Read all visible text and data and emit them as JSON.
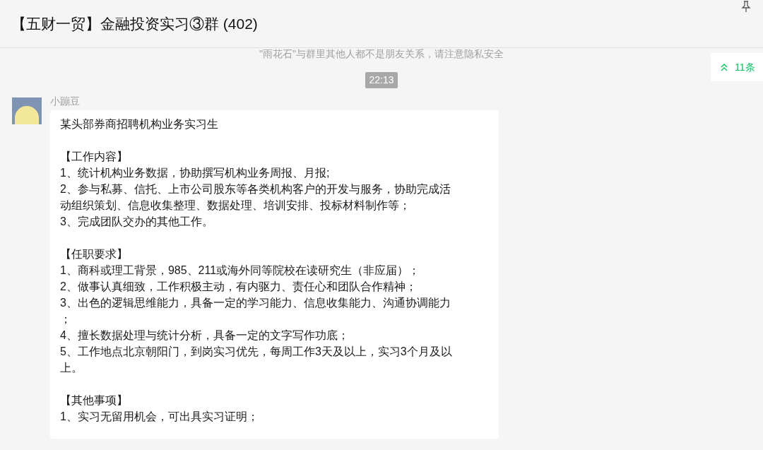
{
  "window": {
    "title": "【五财一贸】金融投资实习③群 (402)"
  },
  "notice": "\"雨花石\"与群里其他人都不是朋友关系，请注意隐私安全",
  "unread_badge": "11条",
  "timestamp": "22:13",
  "message": {
    "sender": "小蹦豆",
    "blocks": [
      [
        "某头部券商招聘机构业务实习生"
      ],
      [
        "【工作内容】",
        "1、统计机构业务数据，协助撰写机构业务周报、月报;",
        "2、参与私募、信托、上市公司股东等各类机构客户的开发与服务，协助完成活",
        "动组织策划、信息收集整理、数据处理、培训安排、投标材料制作等；",
        "3、完成团队交办的其他工作。"
      ],
      [
        "【任职要求】",
        "1、商科或理工背景，985、211或海外同等院校在读研究生（非应届）；",
        "2、做事认真细致，工作积极主动，有内驱力、责任心和团队合作精神；",
        "3、出色的逻辑思维能力，具备一定的学习能力、信息收集能力、沟通协调能力",
        "；",
        "4、擅长数据处理与统计分析，具备一定的文字写作功底；",
        "5、工作地点北京朝阳门，到岗实习优先，每周工作3天及以上，实习3个月及以",
        "上。"
      ],
      [
        "【其他事项】",
        "1、实习无留用机会，可出具实习证明；"
      ]
    ]
  }
}
